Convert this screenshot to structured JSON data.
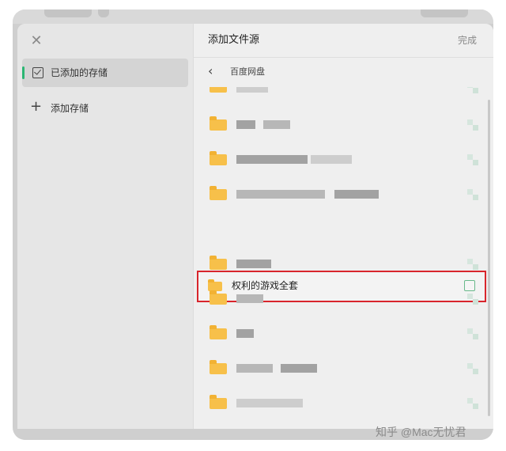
{
  "dialog": {
    "title": "添加文件源",
    "done_label": "完成",
    "close_icon": "close-icon"
  },
  "sidebar": {
    "items": [
      {
        "label": "已添加的存储",
        "icon": "checkbox-icon",
        "selected": true
      },
      {
        "label": "添加存储",
        "icon": "plus-icon",
        "selected": false
      }
    ]
  },
  "breadcrumb": {
    "back_icon": "chevron-left-icon",
    "location": "百度网盘"
  },
  "file_list": {
    "highlighted_item": {
      "name": "权利的游戏全套",
      "icon": "folder-icon",
      "checked": false
    }
  },
  "watermark": "知乎 @Mac无忧君",
  "colors": {
    "accent": "#2bb673",
    "highlight_border": "#d8252c",
    "folder": "#f7c04a"
  }
}
